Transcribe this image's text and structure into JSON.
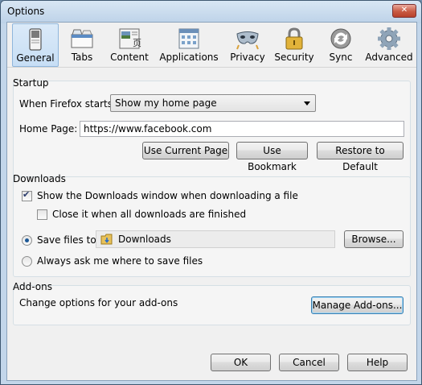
{
  "window": {
    "title": "Options",
    "close_label": "✕"
  },
  "toolbar": {
    "tabs": [
      {
        "label": "General",
        "icon": "general-icon",
        "selected": true
      },
      {
        "label": "Tabs",
        "icon": "tabs-icon"
      },
      {
        "label": "Content",
        "icon": "content-icon"
      },
      {
        "label": "Applications",
        "icon": "applications-icon"
      },
      {
        "label": "Privacy",
        "icon": "privacy-mask-icon"
      },
      {
        "label": "Security",
        "icon": "padlock-icon"
      },
      {
        "label": "Sync",
        "icon": "sync-icon"
      },
      {
        "label": "Advanced",
        "icon": "gear-icon"
      }
    ]
  },
  "startup": {
    "title": "Startup",
    "when_label": "When Firefox starts:",
    "when_value": "Show my home page",
    "home_label": "Home Page:",
    "home_value": "https://www.facebook.com",
    "use_current": "Use Current Page",
    "use_bookmark": "Use Bookmark",
    "restore_default": "Restore to Default"
  },
  "downloads": {
    "title": "Downloads",
    "show_window": "Show the Downloads window when downloading a file",
    "show_window_checked": true,
    "close_it": "Close it when all downloads are finished",
    "close_it_checked": false,
    "save_files_label": "Save files to",
    "save_folder": "Downloads",
    "browse": "Browse...",
    "always_ask": "Always ask me where to save files",
    "selected_option": "save_files"
  },
  "addons": {
    "title": "Add-ons",
    "description": "Change options for your add-ons",
    "manage": "Manage Add-ons..."
  },
  "footer": {
    "ok": "OK",
    "cancel": "Cancel",
    "help": "Help"
  }
}
